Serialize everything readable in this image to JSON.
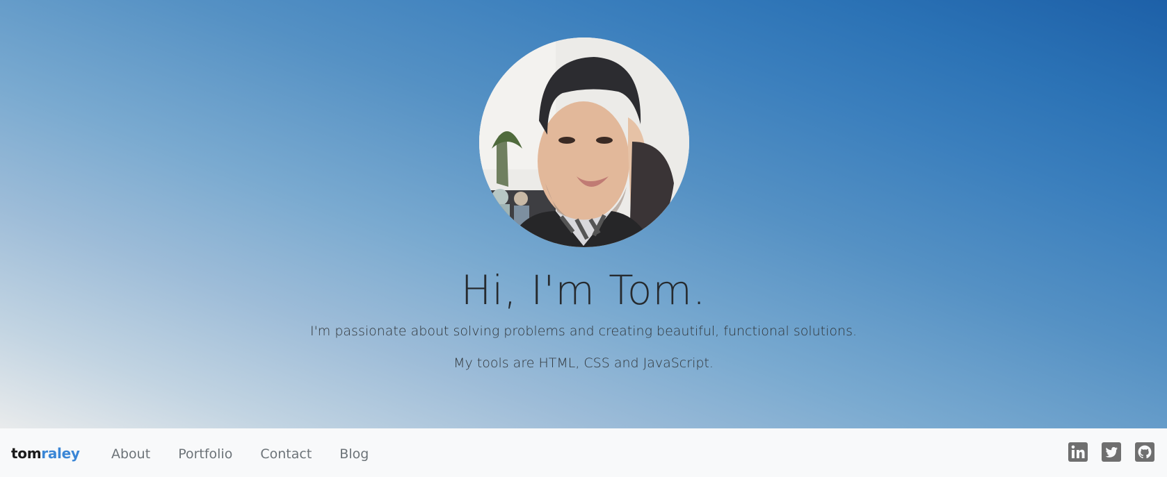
{
  "hero": {
    "avatar_alt": "Portrait of Tom",
    "headline": "Hi, I'm Tom.",
    "tagline_1": "I'm passionate about solving problems and creating beautiful, functional solutions.",
    "tagline_2": "My tools are HTML, CSS and JavaScript."
  },
  "navbar": {
    "brand_first": "tom",
    "brand_last": "raley",
    "links": [
      "About",
      "Portfolio",
      "Contact",
      "Blog"
    ],
    "social": [
      {
        "name": "LinkedIn",
        "icon": "linkedin-icon"
      },
      {
        "name": "Twitter",
        "icon": "twitter-icon"
      },
      {
        "name": "GitHub",
        "icon": "github-icon"
      }
    ]
  },
  "colors": {
    "brand_accent": "#3a86d6",
    "nav_text": "#6c7378",
    "icon_gray": "#6f6f6f",
    "hero_gradient_top_right": "#1d60a8",
    "hero_gradient_bottom_left": "#e9ebec"
  }
}
